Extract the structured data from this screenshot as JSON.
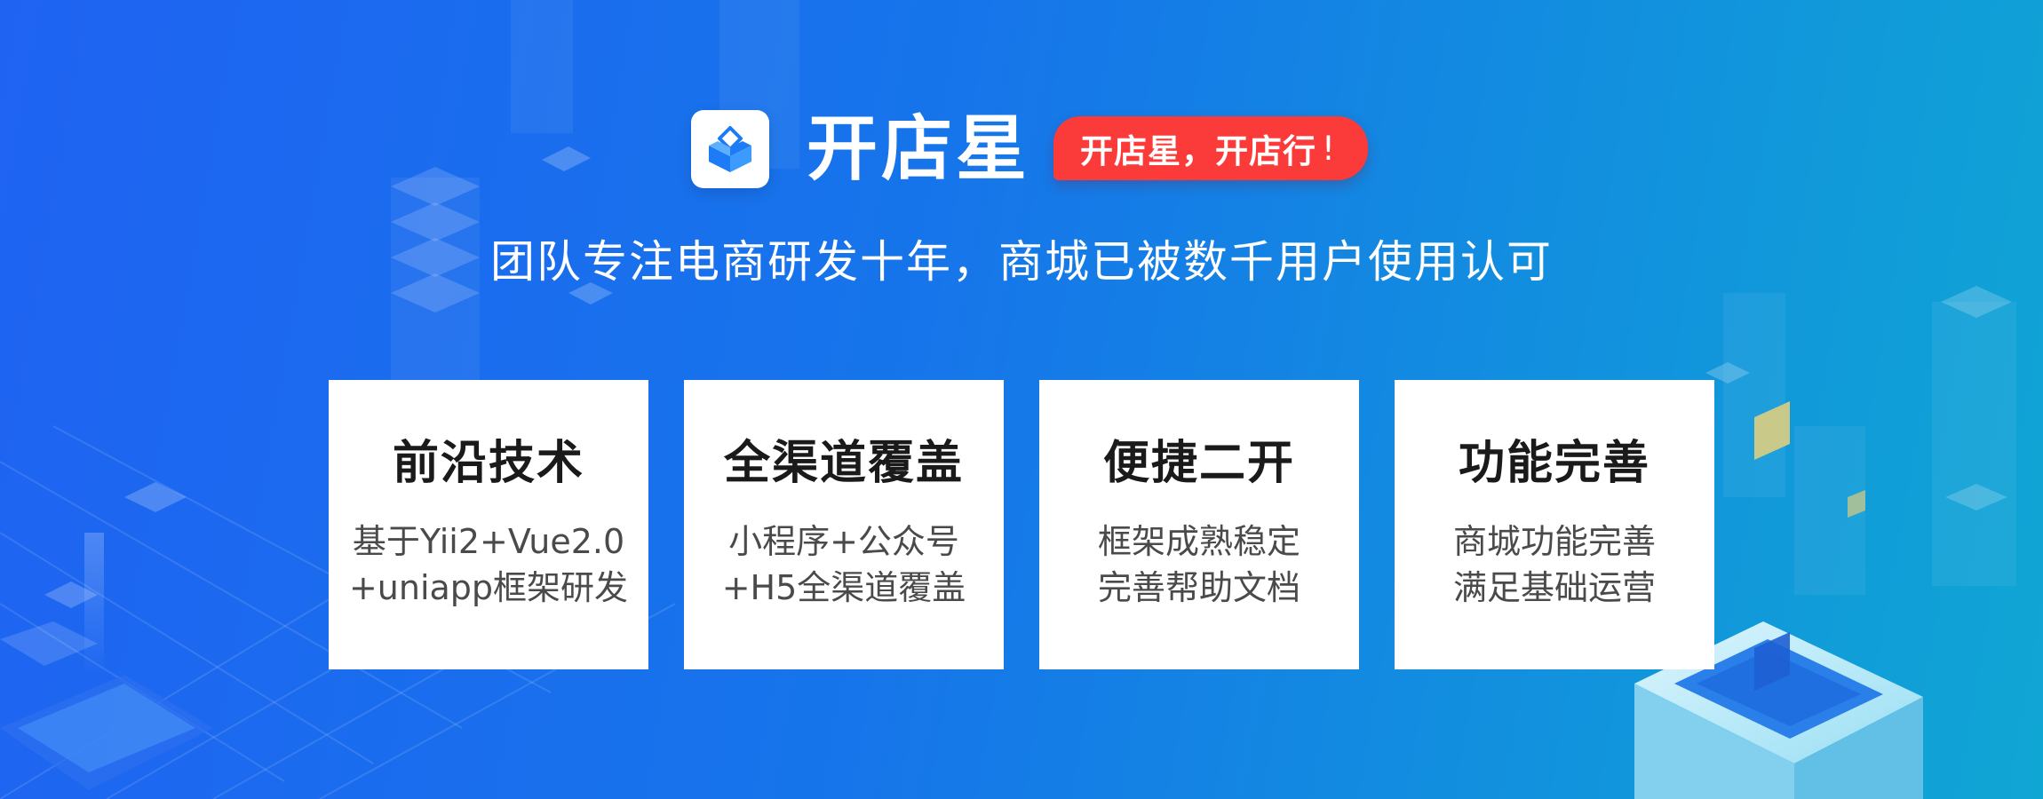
{
  "brand": {
    "logo_icon": "diamond-box-logo-icon",
    "name": "开店星",
    "slogan": "开店星，开店行",
    "slogan_mark": "!"
  },
  "tagline": "团队专注电商研发十年，商城已被数千用户使用认可",
  "features": [
    {
      "title": "前沿技术",
      "lines": [
        "基于Yii2+Vue2.0",
        "+uniapp框架研发"
      ]
    },
    {
      "title": "全渠道覆盖",
      "lines": [
        "小程序+公众号",
        "+H5全渠道覆盖"
      ]
    },
    {
      "title": "便捷二开",
      "lines": [
        "框架成熟稳定",
        "完善帮助文档"
      ]
    },
    {
      "title": "功能完善",
      "lines": [
        "商城功能完善",
        "满足基础运营"
      ]
    }
  ],
  "colors": {
    "background_start": "#1f63f2",
    "background_end": "#10a6d4",
    "badge": "#fb3b3a",
    "logo_primary": "#1d7cf5",
    "card": "#ffffff"
  }
}
